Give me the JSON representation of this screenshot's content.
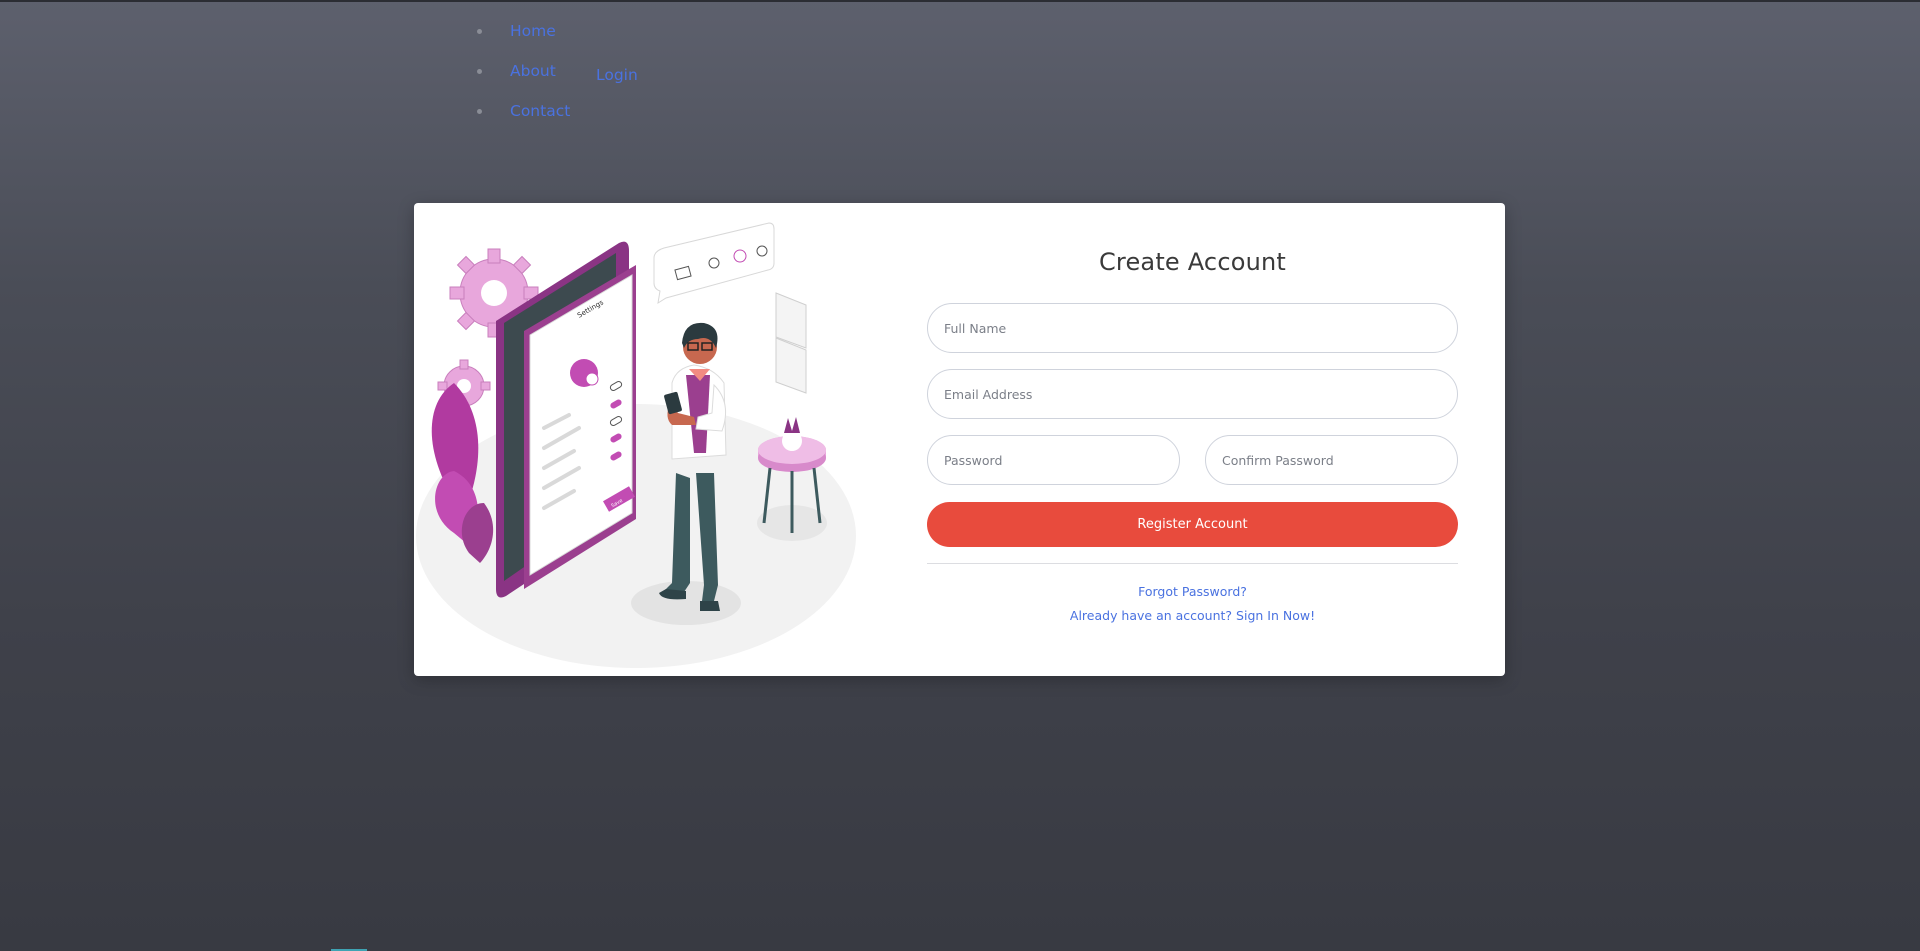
{
  "nav": {
    "items": [
      {
        "label": "Home"
      },
      {
        "label": "About"
      },
      {
        "label": "Contact"
      }
    ],
    "login_label": "Login"
  },
  "form": {
    "title": "Create Account",
    "full_name_placeholder": "Full Name",
    "email_placeholder": "Email Address",
    "password_placeholder": "Password",
    "confirm_password_placeholder": "Confirm Password",
    "submit_label": "Register Account",
    "forgot_password_label": "Forgot Password?",
    "sign_in_label": "Already have an account? Sign In Now!"
  },
  "illustration": {
    "phone_status": "Settings",
    "phone_button": "Save"
  },
  "colors": {
    "accent": "#e84b3d",
    "link": "#4a72e0",
    "illustration_primary": "#9b3f8f",
    "illustration_light": "#e8a7dc"
  }
}
